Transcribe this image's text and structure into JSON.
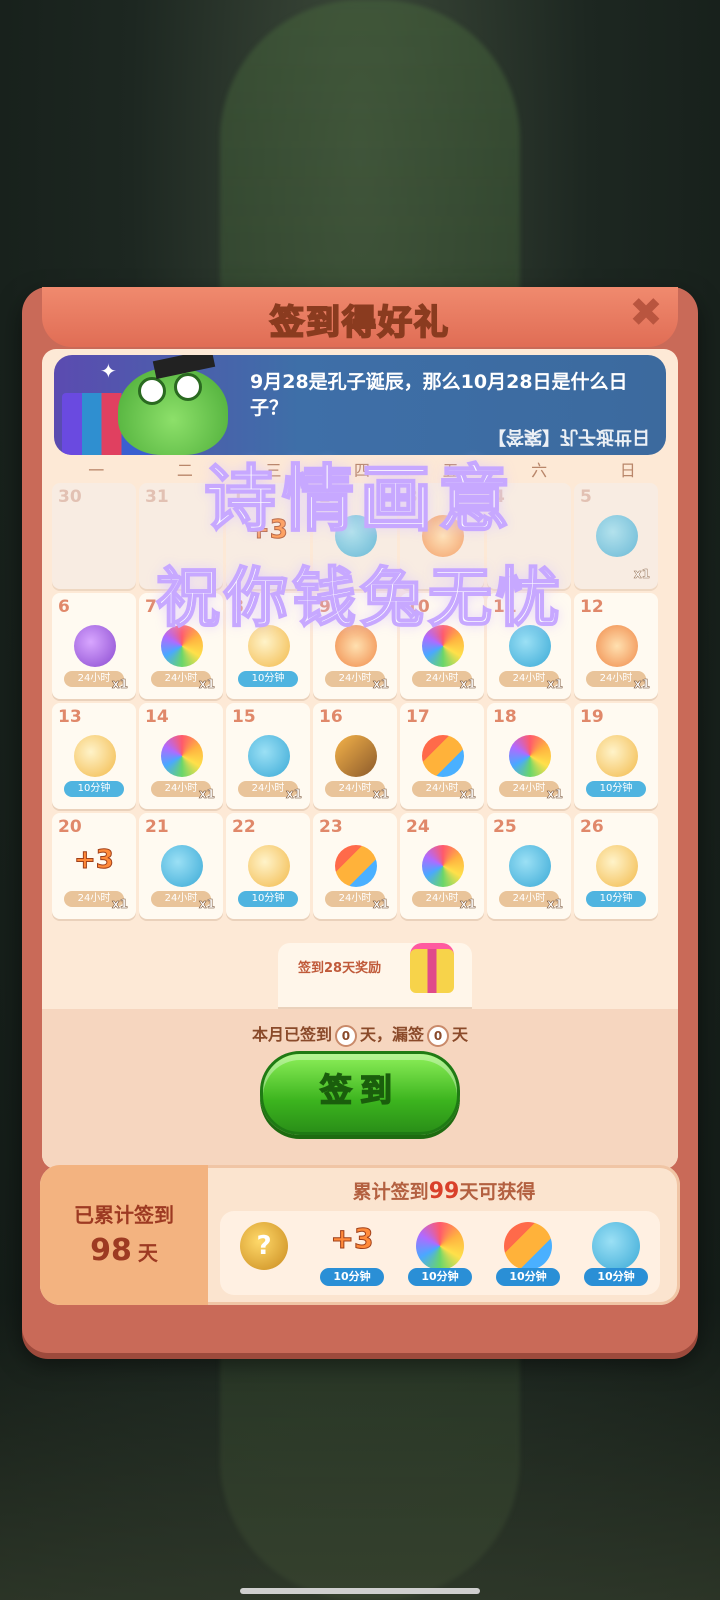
{
  "dialog": {
    "title": "签到得好礼",
    "close_icon": "✖"
  },
  "banner": {
    "question": "9月28是孔子诞辰，那么10月28日是什么日子？",
    "answer": "【答案】孔子逝世日"
  },
  "weekdays": [
    "一",
    "二",
    "三",
    "四",
    "五",
    "六",
    "日"
  ],
  "calendar": [
    {
      "day": "30",
      "past": true,
      "icon": "",
      "tag": "",
      "qty": ""
    },
    {
      "day": "31",
      "past": true,
      "icon": "",
      "tag": "",
      "qty": ""
    },
    {
      "day": "1",
      "past": true,
      "icon": "plus3",
      "tag": "",
      "qty": ""
    },
    {
      "day": "2",
      "past": true,
      "icon": "chick",
      "tag": "",
      "qty": ""
    },
    {
      "day": "3",
      "past": true,
      "icon": "clock",
      "tag": "",
      "qty": ""
    },
    {
      "day": "4",
      "past": true,
      "icon": "",
      "tag": "",
      "qty": ""
    },
    {
      "day": "5",
      "past": true,
      "icon": "chick",
      "tag": "",
      "qty": "x1"
    },
    {
      "day": "6",
      "past": false,
      "icon": "owl",
      "tag": "24小时",
      "qty": "x1"
    },
    {
      "day": "7",
      "past": false,
      "icon": "peacock",
      "tag": "24小时",
      "qty": "x1"
    },
    {
      "day": "8",
      "past": false,
      "icon": "bottle",
      "tag": "10分钟",
      "qty": ""
    },
    {
      "day": "9",
      "past": false,
      "icon": "clock",
      "tag": "24小时",
      "qty": "x1"
    },
    {
      "day": "10",
      "past": false,
      "icon": "peacock",
      "tag": "24小时",
      "qty": "x1"
    },
    {
      "day": "11",
      "past": false,
      "icon": "chick",
      "tag": "24小时",
      "qty": "x1"
    },
    {
      "day": "12",
      "past": false,
      "icon": "clock",
      "tag": "24小时",
      "qty": "x1"
    },
    {
      "day": "13",
      "past": false,
      "icon": "bottle",
      "tag": "10分钟",
      "qty": ""
    },
    {
      "day": "14",
      "past": false,
      "icon": "peacock",
      "tag": "24小时",
      "qty": "x1"
    },
    {
      "day": "15",
      "past": false,
      "icon": "chick",
      "tag": "24小时",
      "qty": "x1"
    },
    {
      "day": "16",
      "past": false,
      "icon": "board",
      "tag": "24小时",
      "qty": "x1"
    },
    {
      "day": "17",
      "past": false,
      "icon": "rocket",
      "tag": "24小时",
      "qty": "x1"
    },
    {
      "day": "18",
      "past": false,
      "icon": "peacock",
      "tag": "24小时",
      "qty": "x1"
    },
    {
      "day": "19",
      "past": false,
      "icon": "bottle",
      "tag": "10分钟",
      "qty": ""
    },
    {
      "day": "20",
      "past": false,
      "icon": "plus3",
      "tag": "24小时",
      "qty": "x1"
    },
    {
      "day": "21",
      "past": false,
      "icon": "chick",
      "tag": "24小时",
      "qty": "x1"
    },
    {
      "day": "22",
      "past": false,
      "icon": "bottle",
      "tag": "10分钟",
      "qty": ""
    },
    {
      "day": "23",
      "past": false,
      "icon": "rocket",
      "tag": "24小时",
      "qty": "x1"
    },
    {
      "day": "24",
      "past": false,
      "icon": "peacock",
      "tag": "24小时",
      "qty": "x1"
    },
    {
      "day": "25",
      "past": false,
      "icon": "chick",
      "tag": "24小时",
      "qty": "x1"
    },
    {
      "day": "26",
      "past": false,
      "icon": "bottle",
      "tag": "10分钟",
      "qty": ""
    }
  ],
  "reward28": {
    "label": "签到28天奖励",
    "icon": "gift-icon"
  },
  "status": {
    "prefix": "本月已签到",
    "signed": "0",
    "mid": "天，漏签",
    "missed": "0",
    "suffix": "天"
  },
  "sign_button": "签到",
  "cumulative": {
    "label": "已累计签到",
    "days": "98",
    "unit": "天",
    "title_prefix": "累计签到",
    "target": "99",
    "title_suffix": "天可获得",
    "rewards": [
      {
        "icon": "medal",
        "tag": ""
      },
      {
        "icon": "plus3",
        "tag": "10分钟"
      },
      {
        "icon": "peacock",
        "tag": "10分钟"
      },
      {
        "icon": "rocket",
        "tag": "10分钟"
      },
      {
        "icon": "chick",
        "tag": "10分钟"
      }
    ]
  },
  "overlay": {
    "line1": "诗情画意",
    "line2": "祝你钱兔无忧"
  }
}
